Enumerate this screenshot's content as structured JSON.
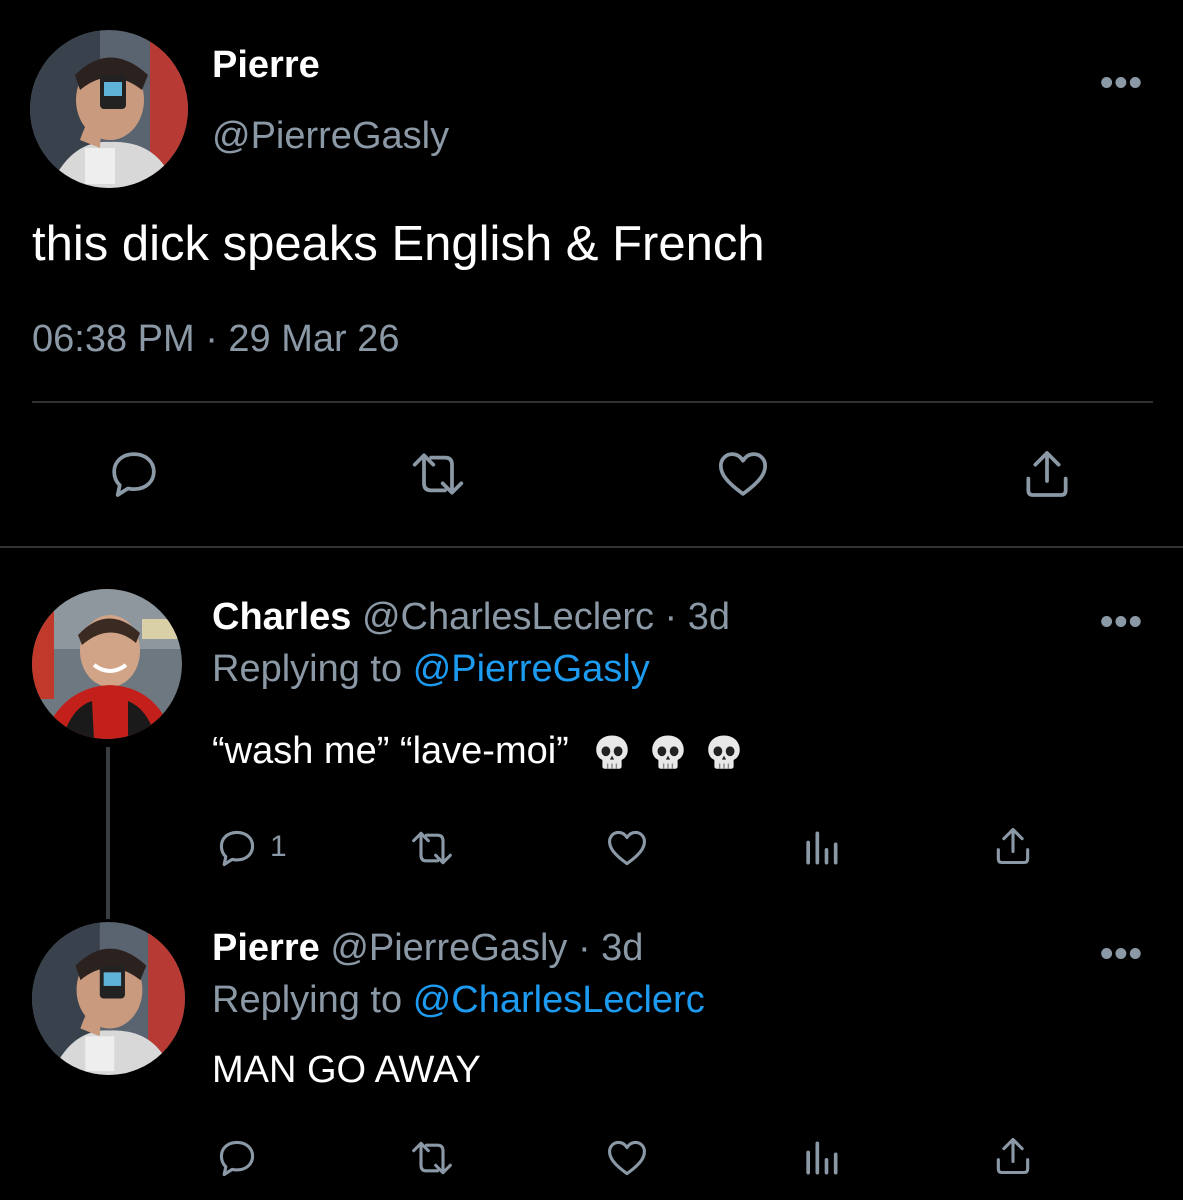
{
  "main_tweet": {
    "author_name": "Pierre",
    "author_handle": "@PierreGasly",
    "text": "this dick speaks English & French",
    "timestamp": "06:38 PM · 29 Mar 26",
    "more_glyph": "•••",
    "actions": [
      "reply-icon",
      "retweet-icon",
      "like-icon",
      "share-icon"
    ]
  },
  "replies": [
    {
      "author_name": "Charles",
      "author_handle": "@CharlesLeclerc · 3d",
      "replying_prefix": "Replying to",
      "replying_to": "@PierreGasly",
      "text": "“wash me” “lave-moi”",
      "emoji": [
        "skull",
        "skull",
        "skull"
      ],
      "reply_count": "1",
      "more_glyph": "•••",
      "actions": [
        "reply-icon",
        "retweet-icon",
        "like-icon",
        "analytics-icon",
        "share-icon"
      ]
    },
    {
      "author_name": "Pierre",
      "author_handle": "@PierreGasly · 3d",
      "replying_prefix": "Replying to",
      "replying_to": "@CharlesLeclerc",
      "text": "MAN GO AWAY",
      "more_glyph": "•••",
      "actions": [
        "reply-icon",
        "retweet-icon",
        "like-icon",
        "analytics-icon",
        "share-icon"
      ]
    }
  ],
  "colors": {
    "background": "#000000",
    "text_primary": "#ffffff",
    "text_secondary": "#8b98a5",
    "link": "#1d9bf0",
    "divider": "#2f3336"
  }
}
